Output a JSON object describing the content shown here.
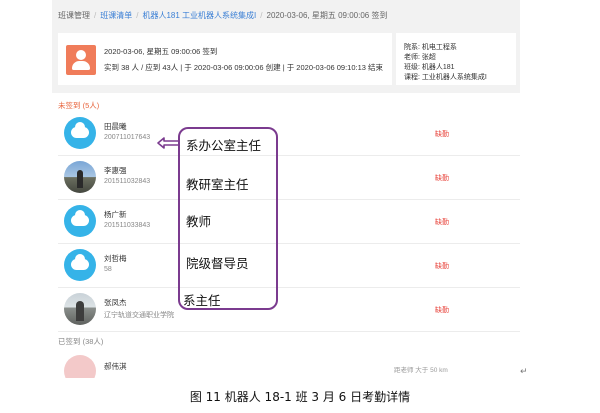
{
  "breadcrumb": {
    "items": [
      "班课管理",
      "班课清单",
      "机器人181 工业机器人系统集成I",
      "2020-03-06, 星期五 09:00:06 签到"
    ]
  },
  "session": {
    "datetime": "2020-03-06, 星期五 09:00:06 签到",
    "summary": "实到 38 人 / 应到 43人 | 于 2020-03-06 09:00:06 创建 | 于 2020-03-06 09:10:13 结束"
  },
  "course_info": {
    "department": "院系: 机电工程系",
    "teacher": "老师: 张超",
    "class": "班级: 机器人181",
    "course": "课程: 工业机器人系统集成I"
  },
  "absent": {
    "header": "未签到 (5人)",
    "students": [
      {
        "name": "田晨曦",
        "id": "200711017643",
        "status": "缺勤"
      },
      {
        "name": "李惠强",
        "id": "201511032843",
        "status": "缺勤"
      },
      {
        "name": "杨广新",
        "id": "201511033843",
        "status": "缺勤"
      },
      {
        "name": "刘哲梅",
        "id": "58",
        "status": "缺勤"
      },
      {
        "name": "张凤杰",
        "id": "辽宁轨道交通职业学院",
        "status": "缺勤"
      }
    ]
  },
  "present": {
    "header": "已签到 (38人)",
    "students": [
      {
        "name": "郝伟淇",
        "distance": "距老师 大于 50 km"
      }
    ]
  },
  "annotation": {
    "roles": [
      "系办公室主任",
      "教研室主任",
      "教师",
      "院级督导员",
      "系主任"
    ],
    "border_color": "#7b3b8f"
  },
  "caption": "图 11   机器人 18-1 班 3 月 6 日考勤详情",
  "return_mark": "↵"
}
